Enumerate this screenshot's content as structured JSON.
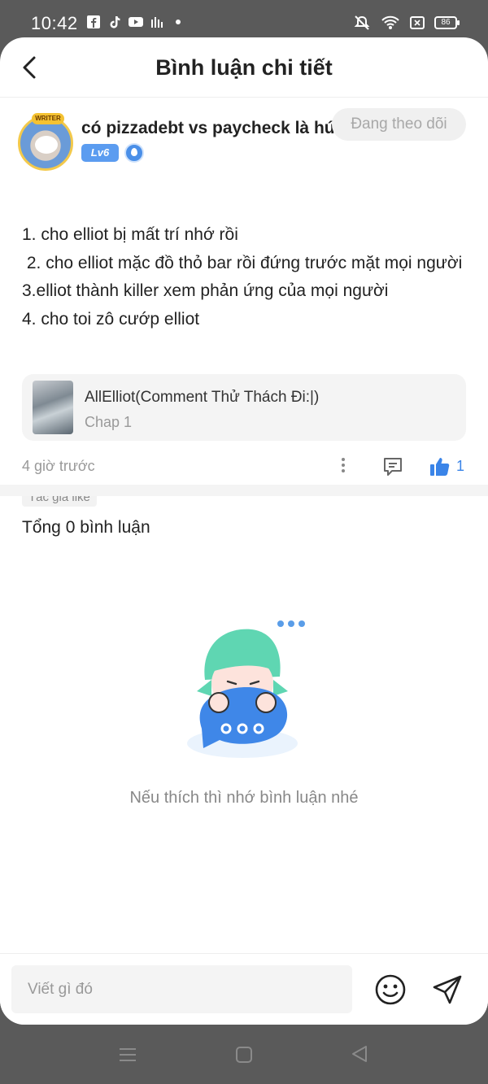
{
  "status_bar": {
    "time": "10:42",
    "battery": "86"
  },
  "header": {
    "title": "Bình luận chi tiết"
  },
  "comment": {
    "username": "có pizzadebt vs paycheck là hú",
    "level": "Lv6",
    "avatar_badge": "WRITER",
    "follow_label": "Đang theo dõi",
    "lines": [
      "1. cho elliot bị mất trí nhớ rồi",
      " 2. cho elliot mặc đồ thỏ bar rồi đứng trước mặt mọi người",
      "3.elliot thành killer xem phản ứng của mọi người",
      "4. cho toi zô cướp elliot"
    ],
    "story": {
      "title": "AllElliot(Comment Thử Thách Đi:|)",
      "chapter": "Chap 1"
    },
    "time": "4 giờ trước",
    "like_count": "1",
    "author_like": "Tác giả like"
  },
  "replies": {
    "total_label": "Tổng 0 bình luận",
    "empty_text": "Nếu thích thì nhớ bình luận nhé"
  },
  "composer": {
    "placeholder": "Viết gì đó"
  },
  "colors": {
    "accent": "#3a84e8",
    "level_badge": "#5b9cf0",
    "mascot_hair": "#5fd6b2",
    "bubble": "#3f87e8"
  },
  "icons": [
    "back-icon",
    "more-icon",
    "comment-icon",
    "thumbs-up-icon",
    "emoji-icon",
    "send-icon",
    "menu-icon",
    "home-icon",
    "nav-back-icon"
  ]
}
